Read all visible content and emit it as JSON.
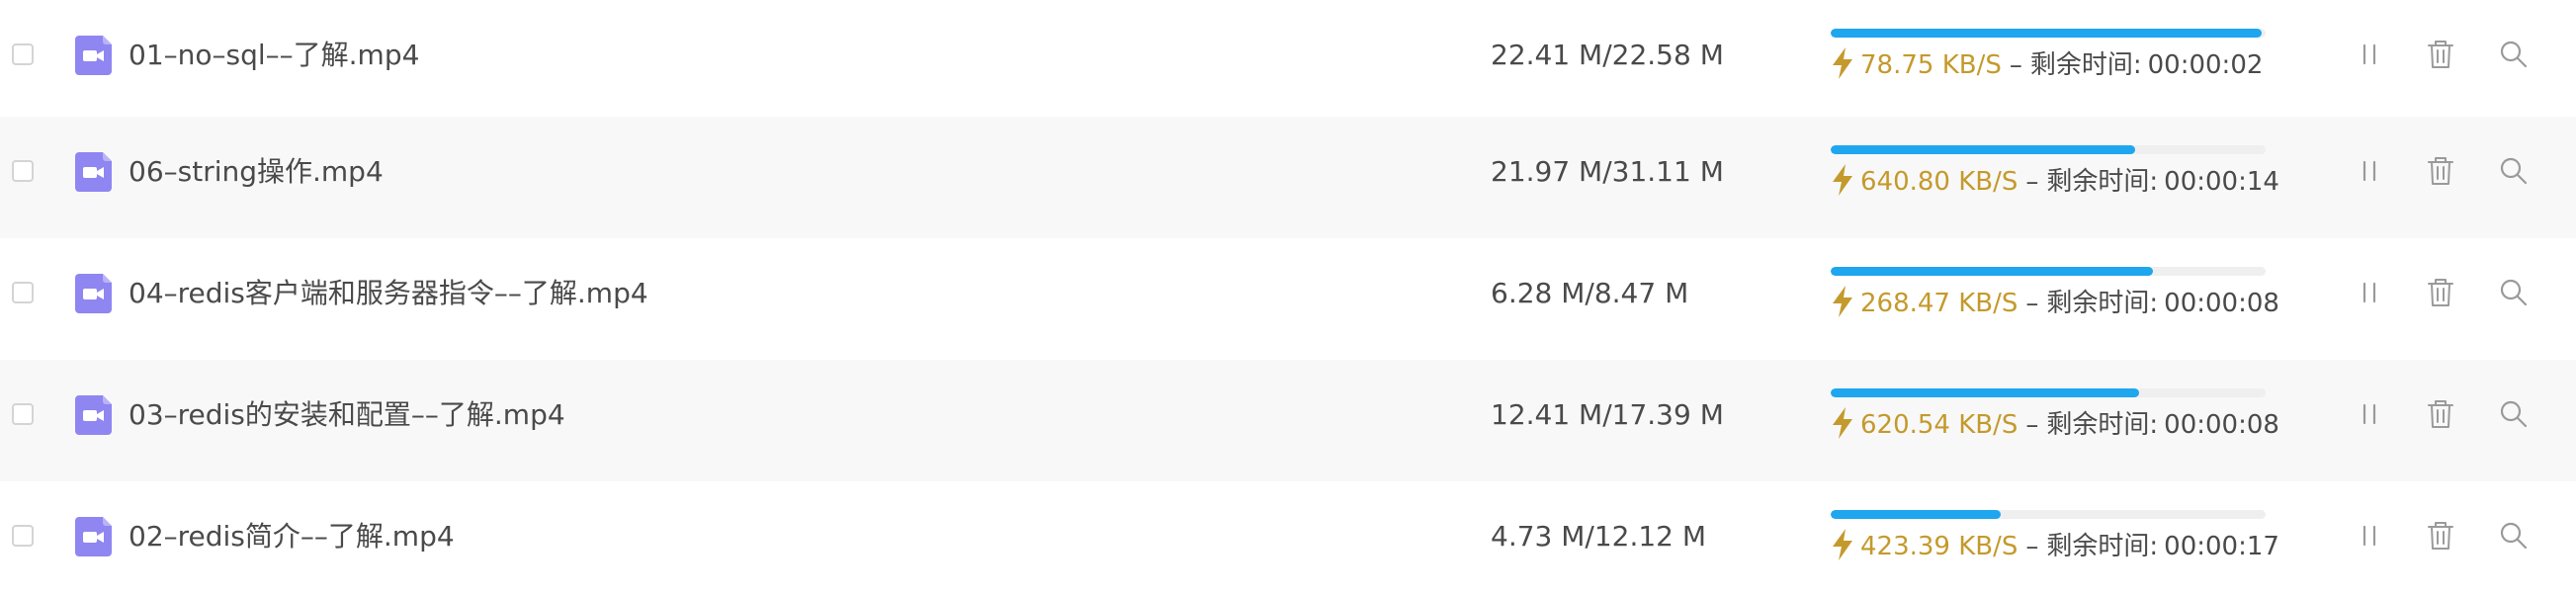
{
  "colors": {
    "progress": "#1ea6ee",
    "speed": "#c49a2c",
    "file_icon": "#8f86f2",
    "row_alt_bg": "#f8f8f8"
  },
  "icons": {
    "file": "video-file-icon",
    "speed": "lightning-bolt-icon",
    "pause": "pause-icon",
    "delete": "trash-icon",
    "search": "search-icon"
  },
  "labels": {
    "separator": "–",
    "remaining": "剩余时间:"
  },
  "downloads": [
    {
      "name": "01–no–sql––了解.mp4",
      "size": "22.41 M/22.58 M",
      "progress": 0.99,
      "speed": "78.75 KB/S",
      "remaining": "00:00:02"
    },
    {
      "name": "06–string操作.mp4",
      "size": "21.97 M/31.11 M",
      "progress": 0.7,
      "speed": "640.80 KB/S",
      "remaining": "00:00:14"
    },
    {
      "name": "04–redis客户端和服务器指令––了解.mp4",
      "size": "6.28 M/8.47 M",
      "progress": 0.74,
      "speed": "268.47 KB/S",
      "remaining": "00:00:08"
    },
    {
      "name": "03–redis的安装和配置––了解.mp4",
      "size": "12.41 M/17.39 M",
      "progress": 0.71,
      "speed": "620.54 KB/S",
      "remaining": "00:00:08"
    },
    {
      "name": "02–redis简介––了解.mp4",
      "size": "4.73 M/12.12 M",
      "progress": 0.39,
      "speed": "423.39 KB/S",
      "remaining": "00:00:17"
    }
  ]
}
